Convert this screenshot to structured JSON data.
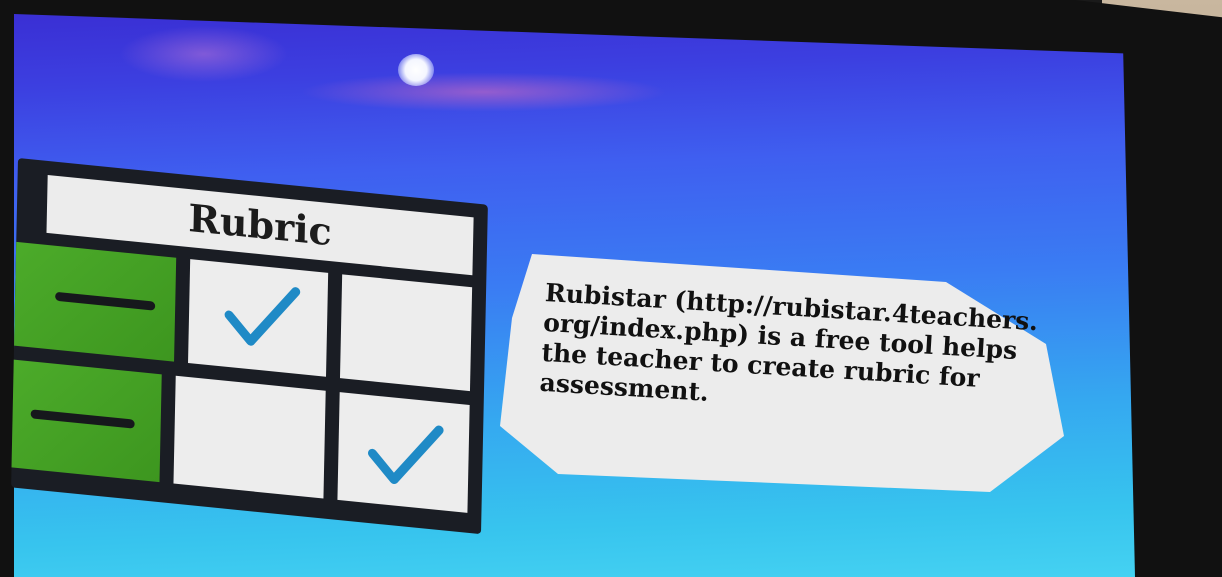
{
  "rubric": {
    "title": "Rubric",
    "rows": [
      {
        "cells": [
          "dash",
          "check",
          "empty"
        ]
      },
      {
        "cells": [
          "dash",
          "empty",
          "check"
        ]
      }
    ],
    "colors": {
      "green": "#45a225",
      "check": "#1f8ac6",
      "frame": "#1a1d24",
      "cell": "#ececec"
    }
  },
  "callout": {
    "lines": [
      "Rubistar (http://rubistar.4teachers.",
      "org/index.php) is a free tool helps",
      "the teacher to create rubric for",
      "assessment."
    ]
  },
  "scene": {
    "screen_gradient": [
      "#3a2fd4",
      "#3f5ff0",
      "#35a8f0",
      "#45d2f2"
    ]
  }
}
